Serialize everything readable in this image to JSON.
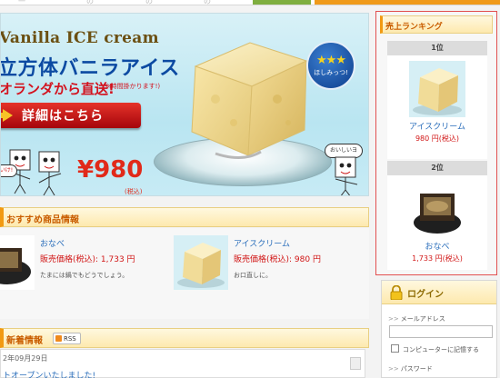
{
  "banner": {
    "title_en": "Vanilla ICE cream",
    "title_jp": "立方体バニラアイス",
    "subtitle": "オランダから直送!",
    "note": "(※時間掛かります!)",
    "button_label": "詳細はこちら",
    "price": "¥980",
    "tax": "(税込)",
    "badge_stars": "★★★",
    "badge_text": "ほしみっつ!",
    "bubble_right": "おいしいヨ",
    "bubble_left": "いけ!"
  },
  "recommend": {
    "title": "おすすめ商品情報",
    "items": [
      {
        "name": "おなべ",
        "price": "販売価格(税込): 1,733 円",
        "desc": "たまには鍋でもどうでしょう。"
      },
      {
        "name": "アイスクリーム",
        "price": "販売価格(税込): 980 円",
        "desc": "お口直しに。"
      }
    ]
  },
  "news": {
    "title": "新着情報",
    "rss_label": "RSS",
    "date": "2年09月29日",
    "headline": "トオープンいたしました!"
  },
  "ranking": {
    "title": "売上ランキング",
    "items": [
      {
        "rank": "1位",
        "name": "アイスクリーム",
        "price": "980 円(税込)"
      },
      {
        "rank": "2位",
        "name": "おなべ",
        "price": "1,733 円(税込)"
      }
    ]
  },
  "login": {
    "title": "ログイン",
    "email_label": "メールアドレス",
    "remember_label": "コンピューターに記憶する",
    "password_label": "パスワード",
    "label_marker": ">>"
  },
  "topnav": {
    "tabs": [
      "一",
      "の",
      "の",
      "の"
    ]
  },
  "colors": {
    "accent_orange": "#f29a12",
    "price_red": "#d11515",
    "link_blue": "#2a6ebb",
    "ranking_border": "#e25050"
  }
}
